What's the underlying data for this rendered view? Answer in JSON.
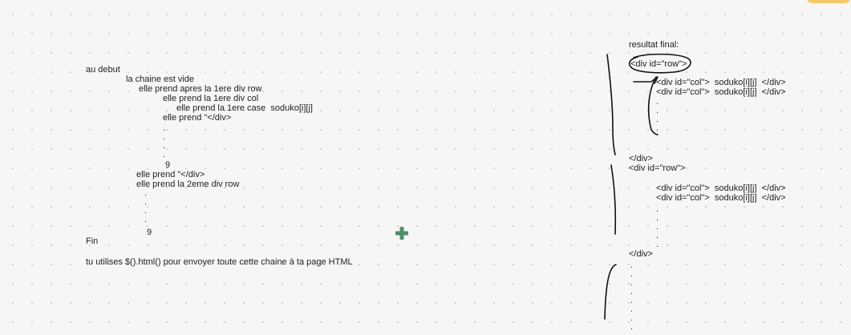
{
  "left_notes": {
    "au_debut": "au debut",
    "chaine_vide": "la chaine est vide",
    "prend_div_row": "elle prend apres la 1ere div row",
    "prend_div_col": "elle prend la 1ere div col",
    "prend_case": "elle prend la 1ere case  soduko[i][j]",
    "prend_close_1": "elle prend \"</div>",
    "nine_1": "9",
    "prend_close_2": "elle prend \"</div>",
    "prend_2eme_row": "elle prend la 2eme div row",
    "nine_2": "9",
    "fin": "Fin",
    "html_note": "tu utilises $().html() pour envoyer toute cette chaine à ta page HTML"
  },
  "right_notes": {
    "title": "resultat final:",
    "row_open_1": "<div id=\"row\">",
    "col_1a": "<div id=\"col\">  soduko[i][j]  </div>",
    "col_1b": "<div id=\"col\">  soduko[i][j]  </div>",
    "row_close_1": "</div>",
    "row_open_2": "<div id=\"row\">",
    "col_2a": "<div id=\"col\">  soduko[i][j]  </div>",
    "col_2b": "<div id=\"col\">  soduko[i][j]  </div>",
    "row_close_2": "</div>"
  },
  "theme": {
    "background": "#f5f6f5",
    "plus_color": "#4f8f6b",
    "accent_tab": "#f7c86a"
  }
}
